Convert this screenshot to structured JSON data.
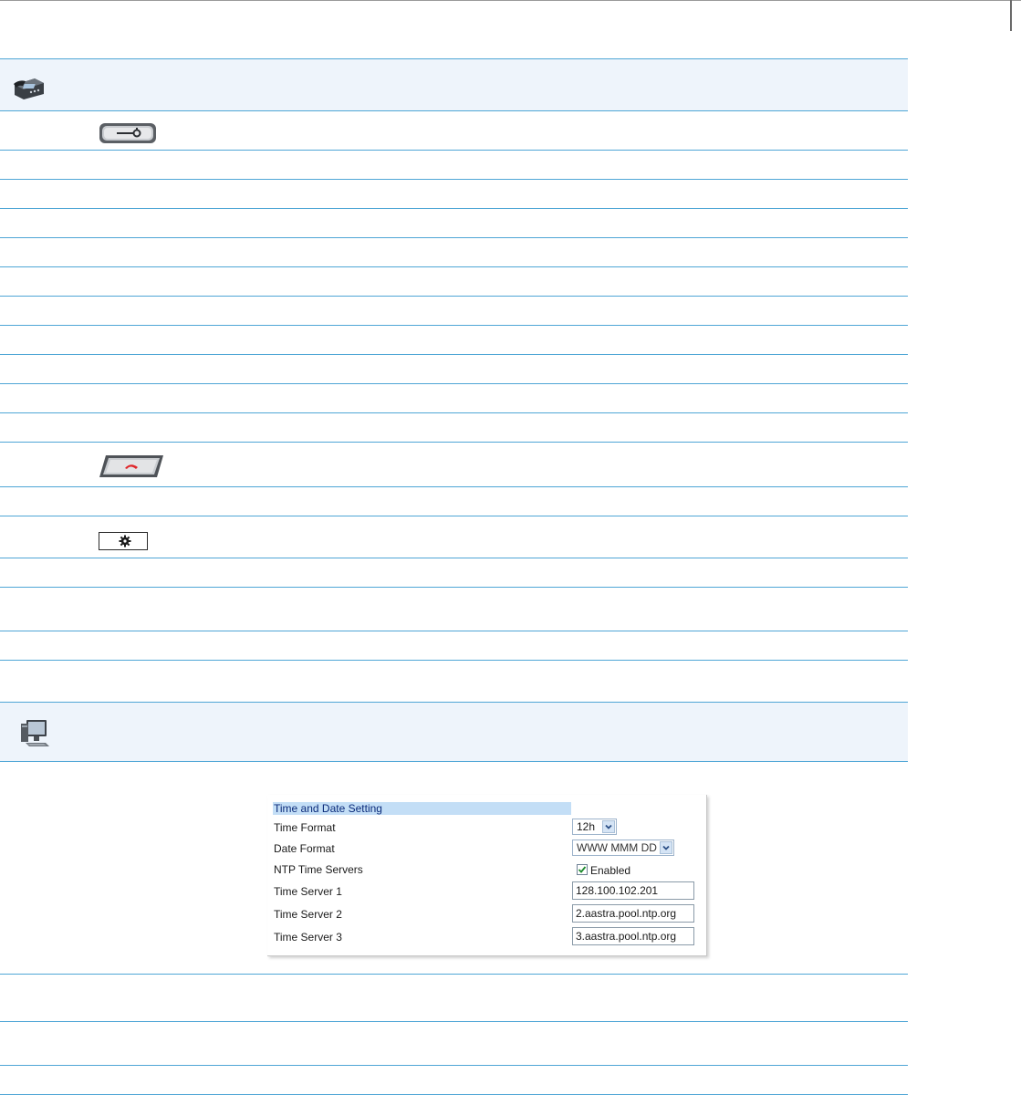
{
  "icons": {
    "phone_ui": "ip-phone-icon",
    "options_key": "options-key-icon",
    "goodbye_key": "goodbye-key-icon",
    "settings_key": "settings-gear-key-icon",
    "web_ui": "computer-icon"
  },
  "colors": {
    "rule": "#4fa6d6",
    "header_bg": "#eef4fb",
    "goodbye_red": "#e0262a",
    "panel_title_bg": "#c3def6",
    "panel_title_fg": "#0b2b7a"
  },
  "web_ui": {
    "section_title": "Time and Date Setting",
    "time_format": {
      "label": "Time Format",
      "value": "12h"
    },
    "date_format": {
      "label": "Date Format",
      "value": "WWW MMM DD"
    },
    "ntp": {
      "label": "NTP Time Servers",
      "checkbox_label": "Enabled",
      "checked": true
    },
    "server1": {
      "label": "Time Server 1",
      "value": "128.100.102.201"
    },
    "server2": {
      "label": "Time Server 2",
      "value": "2.aastra.pool.ntp.org"
    },
    "server3": {
      "label": "Time Server 3",
      "value": "3.aastra.pool.ntp.org"
    }
  }
}
